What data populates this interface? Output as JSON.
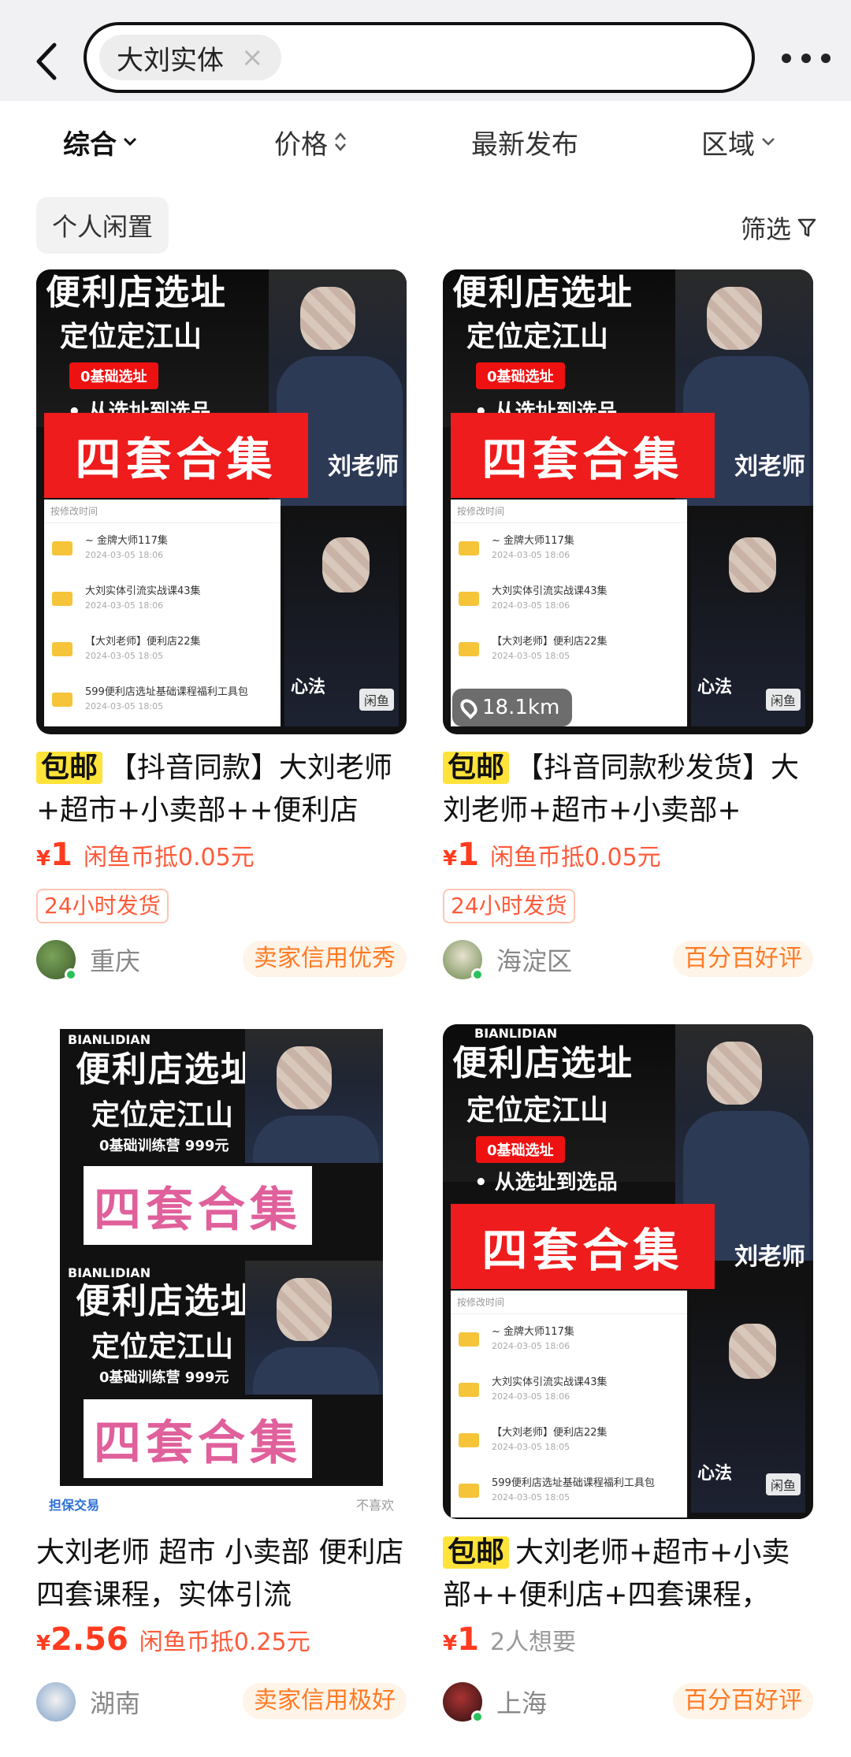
{
  "search": {
    "query": "大刘实体",
    "clear_symbol": "×"
  },
  "sort": {
    "comprehensive": "综合",
    "price": "价格",
    "latest": "最新发布",
    "region": "区域"
  },
  "filter": {
    "personal": "个人闲置",
    "filter_label": "筛选"
  },
  "poster": {
    "title1": "便利店选址",
    "title2": "定位定江山",
    "zero_tag": "0基础选址",
    "bullet": "• 从选址到选品",
    "bundle": "四套合集",
    "teacher": "刘老师",
    "file_header": "按修改时间",
    "side_label": "心法",
    "xianyu": "闲鱼",
    "files": [
      {
        "name": "~ 金牌大师117集",
        "date": "2024-03-05 18:06"
      },
      {
        "name": "大刘实体引流实战课43集",
        "date": "2024-03-05 18:06"
      },
      {
        "name": "【大刘老师】便利店22集",
        "date": "2024-03-05 18:05"
      },
      {
        "name": "599便利店选址基础课程福利工具包",
        "date": "2024-03-05 18:05"
      }
    ],
    "bianlidian": "BIANLIDIAN",
    "zero_camp": "0基础训练营 999元",
    "guarantee": "担保交易",
    "dislike": "不喜欢"
  },
  "items": [
    {
      "baoyou": "包邮",
      "title": "【抖音同款】大刘老师+超市+小卖部++便利店",
      "price_symbol": "¥",
      "price": "1",
      "price_note": "闲鱼币抵0.05元",
      "ship_tag": "24小时发货",
      "city": "重庆",
      "credit": "卖家信用优秀"
    },
    {
      "baoyou": "包邮",
      "title": "【抖音同款秒发货】大刘老师+超市+小卖部+",
      "price_symbol": "¥",
      "price": "1",
      "price_note": "闲鱼币抵0.05元",
      "ship_tag": "24小时发货",
      "distance": "18.1km",
      "city": "海淀区",
      "credit": "百分百好评"
    },
    {
      "title": "大刘老师 超市 小卖部  便利店 四套课程，实体引流",
      "price_symbol": "¥",
      "price": "2.56",
      "price_note": "闲鱼币抵0.25元",
      "city": "湖南",
      "credit": "卖家信用极好"
    },
    {
      "baoyou": "包邮",
      "title": "大刘老师+超市+小卖部++便利店+四套课程，",
      "price_symbol": "¥",
      "price": "1",
      "price_note": "2人想要",
      "city": "上海",
      "credit": "百分百好评"
    }
  ],
  "colors": {
    "accent_red": "#ff3b1f",
    "baoyou_yellow": "#ffe23a",
    "credit_orange": "#ff7a24"
  }
}
